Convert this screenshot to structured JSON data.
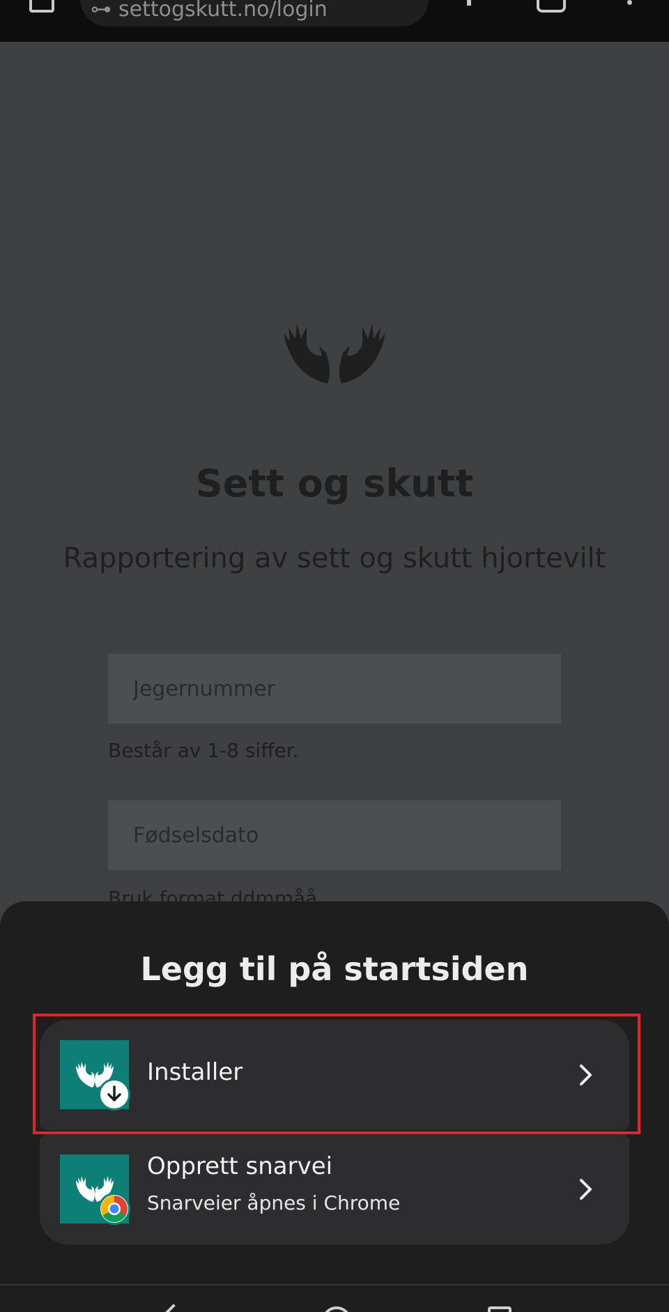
{
  "browser": {
    "url": "settogskutt.no/login",
    "icons": [
      "tab-icon",
      "lock-icon",
      "new-tab-icon",
      "tabs-icon",
      "more-menu-icon"
    ]
  },
  "page": {
    "logo": "antlers-logo",
    "title": "Sett og skutt",
    "subtitle": "Rapportering av sett og skutt hjortevilt",
    "fields": [
      {
        "placeholder": "Jegernummer",
        "value": "",
        "hint": "Består av 1-8 siffer."
      },
      {
        "placeholder": "Fødselsdato",
        "value": "",
        "hint": "Bruk format ddmmåå."
      }
    ]
  },
  "sheet": {
    "title": "Legg til på startsiden",
    "options": [
      {
        "label": "Installer",
        "sublabel": "",
        "icon": "app-install-icon",
        "badge": "download-arrow-icon",
        "highlighted": true
      },
      {
        "label": "Opprett snarvei",
        "sublabel": "Snarveier åpnes i Chrome",
        "icon": "app-shortcut-icon",
        "badge": "chrome-icon",
        "highlighted": false
      }
    ]
  },
  "colors": {
    "app_icon_bg": "#0e7f76",
    "highlight": "#e4232d",
    "sheet_bg": "#1e1e1f",
    "option_bg": "#2d2d2f",
    "page_dim_bg": "#3f4041"
  },
  "navbar": {
    "icons": [
      "back-icon",
      "home-icon",
      "recents-icon"
    ]
  }
}
